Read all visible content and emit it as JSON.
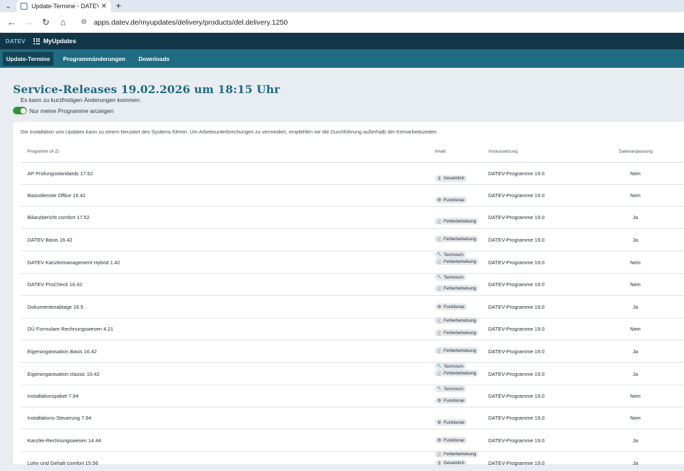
{
  "browser": {
    "tab_title": "Update-Termine - DATEV MyUp",
    "url": "apps.datev.de/myupdates/delivery/products/del.delivery.1250"
  },
  "app": {
    "brand": "DATEV",
    "name": "MyUpdates",
    "nav": [
      {
        "label": "Update-Termine",
        "active": true
      },
      {
        "label": "Programmänderungen",
        "active": false
      },
      {
        "label": "Downloads",
        "active": false
      }
    ]
  },
  "page": {
    "title": "Service-Releases 19.02.2026 um 18:15 Uhr",
    "subtitle": "Es kann zu kurzfristigen Änderungen kommen.",
    "toggle_label": "Nur meine Programme anzeigen",
    "toggle_on": true,
    "notice": "Die Installation von Updates kann zu einem Neustart des Systems führen. Um Arbeitsunterbrechungen zu vermeiden, empfehlen wir die Durchführung außerhalb der Kernarbeitszeiten."
  },
  "table": {
    "headers": {
      "program": "Programm (A Z)",
      "content": "Inhalt",
      "requirement": "Voraussetzung",
      "data": "Datenanpassung"
    },
    "rows": [
      {
        "name": "AP Prüfungsstandards 17.52",
        "badges": [
          {
            "icon": "paragraph-icon",
            "label": "Gesetzlich"
          }
        ],
        "requirement": "DATEV-Programme 19.0",
        "data": "Nein"
      },
      {
        "name": "Basisdienste Office 16.42",
        "badges": [
          {
            "icon": "gear-icon",
            "label": "Funktional"
          }
        ],
        "requirement": "DATEV-Programme 19.0",
        "data": "Nein"
      },
      {
        "name": "Bilanzbericht comfort 17.52",
        "badges": [
          {
            "icon": "info-icon",
            "label": "Fehlerbehebung"
          }
        ],
        "requirement": "DATEV-Programme 19.0",
        "data": "Ja"
      },
      {
        "name": "DATEV Basis 16.42",
        "badges": [
          {
            "icon": "info-icon",
            "label": "Fehlerbehebung"
          },
          {
            "icon": "wrench-icon",
            "label": "Technisch"
          }
        ],
        "requirement": "DATEV-Programme 19.0",
        "data": "Ja"
      },
      {
        "name": "DATEV Kanzleimanagement Hybrid 1.42",
        "badges": [
          {
            "icon": "info-icon",
            "label": "Fehlerbehebung"
          },
          {
            "icon": "wrench-icon",
            "label": "Technisch"
          }
        ],
        "requirement": "DATEV-Programme 19.0",
        "data": "Nein"
      },
      {
        "name": "DATEV ProCheck 16.42",
        "badges": [
          {
            "icon": "info-icon",
            "label": "Fehlerbehebung"
          }
        ],
        "requirement": "DATEV-Programme 19.0",
        "data": "Nein"
      },
      {
        "name": "Dokumentenablage 16.5",
        "badges": [
          {
            "icon": "gear-icon",
            "label": "Funktional"
          },
          {
            "icon": "info-icon",
            "label": "Fehlerbehebung"
          }
        ],
        "requirement": "DATEV-Programme 19.0",
        "data": "Ja"
      },
      {
        "name": "DÜ Formulare Rechnungswesen 4.21",
        "badges": [
          {
            "icon": "info-icon",
            "label": "Fehlerbehebung"
          }
        ],
        "requirement": "DATEV-Programme 19.0",
        "data": "Nein"
      },
      {
        "name": "Eigenorganisation Basis 16.42",
        "badges": [
          {
            "icon": "info-icon",
            "label": "Fehlerbehebung"
          },
          {
            "icon": "wrench-icon",
            "label": "Technisch"
          }
        ],
        "requirement": "DATEV-Programme 19.0",
        "data": "Ja"
      },
      {
        "name": "Eigenorganisation classic 16.42",
        "badges": [
          {
            "icon": "info-icon",
            "label": "Fehlerbehebung"
          },
          {
            "icon": "wrench-icon",
            "label": "Technisch"
          }
        ],
        "requirement": "DATEV-Programme 19.0",
        "data": "Ja"
      },
      {
        "name": "Installationspaket 7.94",
        "badges": [
          {
            "icon": "gear-icon",
            "label": "Funktional"
          }
        ],
        "requirement": "DATEV-Programme 19.0",
        "data": "Nein"
      },
      {
        "name": "Installations-Steuerung 7.94",
        "badges": [
          {
            "icon": "gear-icon",
            "label": "Funktional"
          }
        ],
        "requirement": "DATEV-Programme 19.0",
        "data": "Nein"
      },
      {
        "name": "Kanzlei-Rechnungswesen 14.44",
        "badges": [
          {
            "icon": "gear-icon",
            "label": "Funktional"
          },
          {
            "icon": "info-icon",
            "label": "Fehlerbehebung"
          }
        ],
        "requirement": "DATEV-Programme 19.0",
        "data": "Ja"
      },
      {
        "name": "Lohn und Gehalt comfort 15.56",
        "badges": [
          {
            "icon": "paragraph-icon",
            "label": "Gesetzlich"
          },
          {
            "icon": "info-icon",
            "label": "Fehlerbehebung"
          }
        ],
        "requirement": "DATEV-Programme 19.0",
        "data": "Ja"
      }
    ]
  },
  "colors": {
    "header_dark": "#123647",
    "nav_teal": "#1f6b82",
    "title_teal": "#1d6a83",
    "toggle_green": "#2e9637"
  }
}
